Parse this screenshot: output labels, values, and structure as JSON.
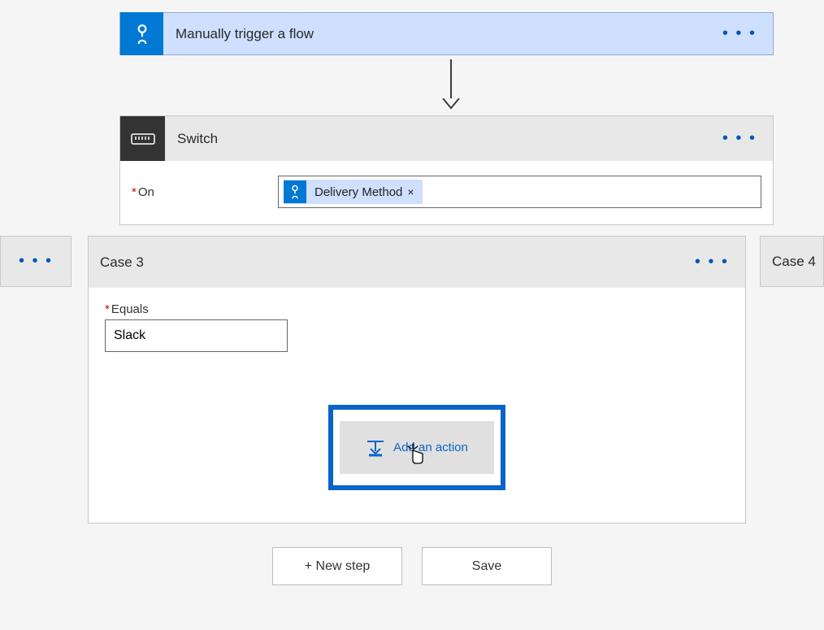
{
  "trigger": {
    "title": "Manually trigger a flow"
  },
  "switch": {
    "title": "Switch",
    "on_label": "On",
    "token": {
      "label": "Delivery Method"
    }
  },
  "case": {
    "title": "Case 3",
    "equals_label": "Equals",
    "equals_value": "Slack",
    "add_action": "Add an action",
    "next_title": "Case 4"
  },
  "footer": {
    "new_step": "+ New step",
    "save": "Save"
  }
}
